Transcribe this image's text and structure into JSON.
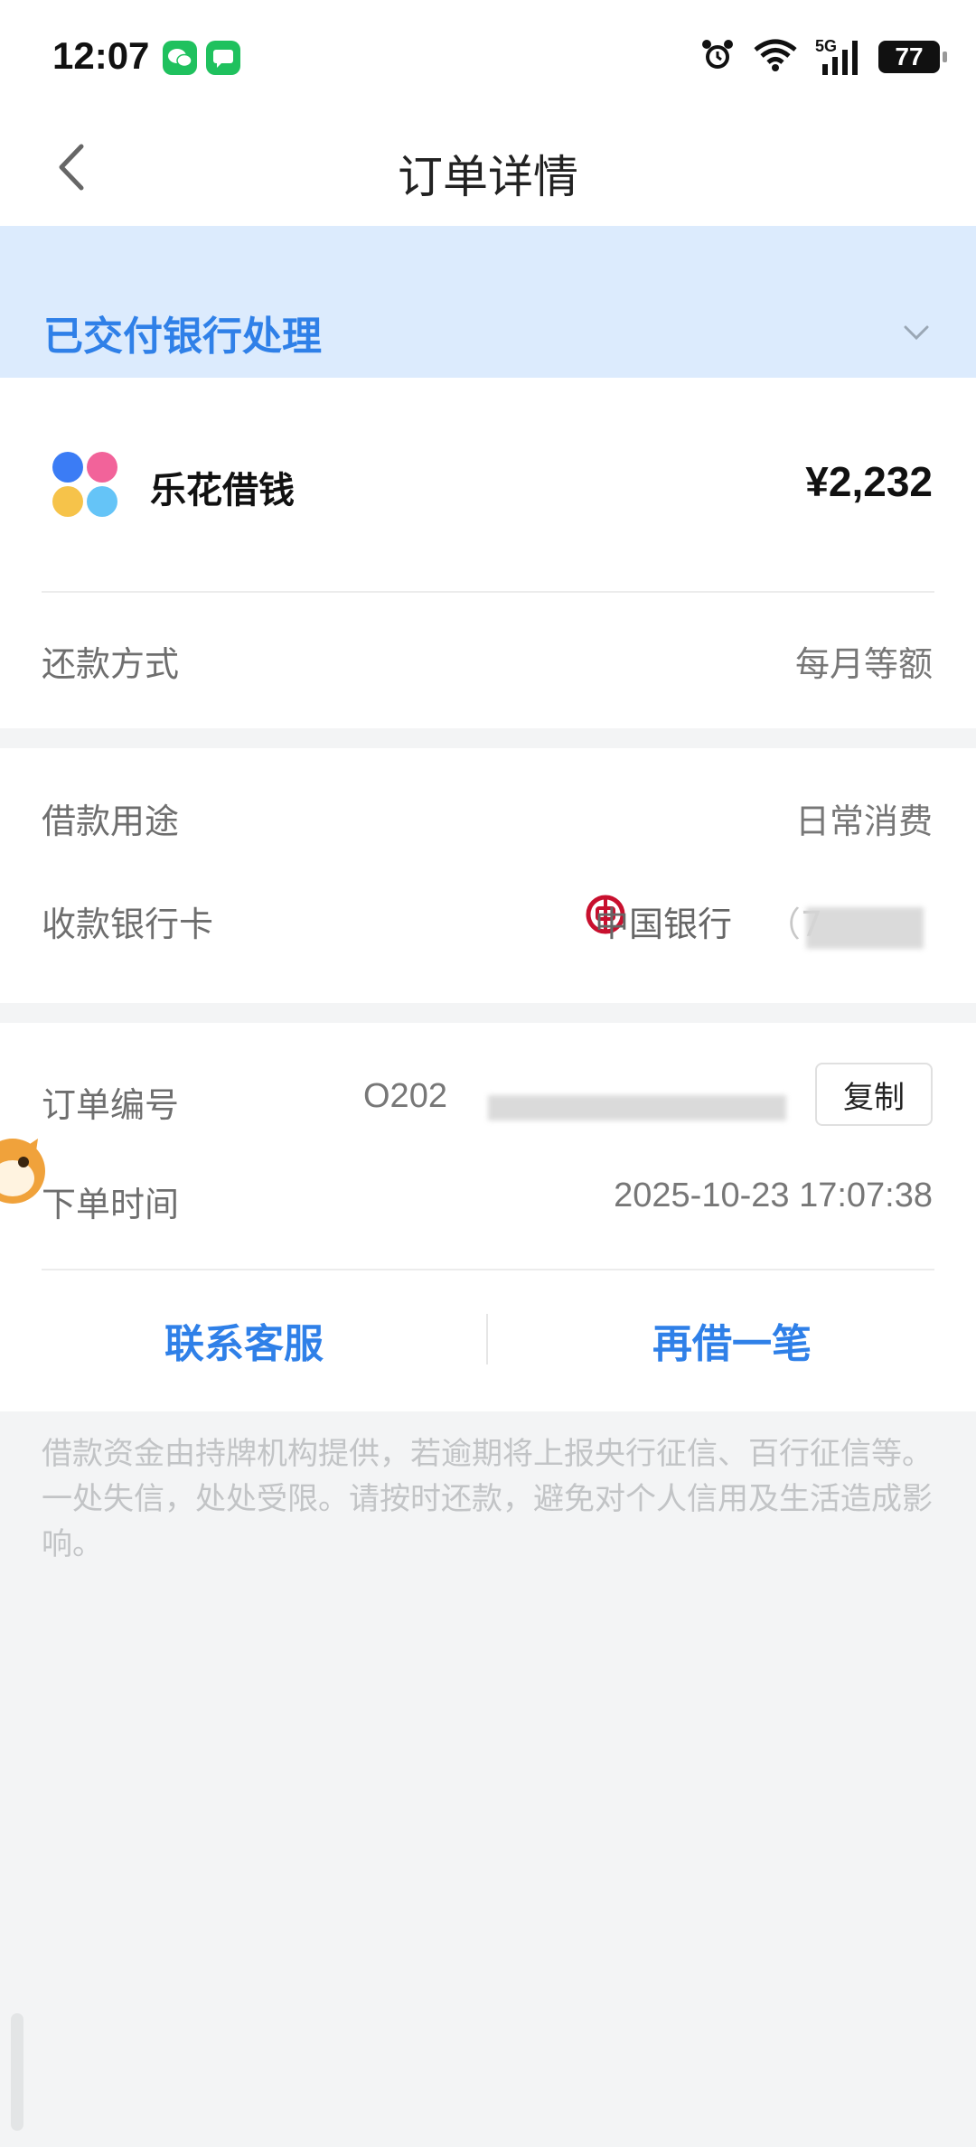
{
  "status_bar": {
    "time": "12:07",
    "signal_label": "5G",
    "battery_level": "77"
  },
  "nav": {
    "title": "订单详情"
  },
  "banner": {
    "status_text": "已交付银行处理"
  },
  "product": {
    "name": "乐花借钱",
    "amount": "¥2,232"
  },
  "repayment": {
    "label": "还款方式",
    "value": "每月等额"
  },
  "loan_purpose": {
    "label": "借款用途",
    "value": "日常消费"
  },
  "bank_card": {
    "label": "收款银行卡",
    "bank_name": "中国银行",
    "card_masked": "（7"
  },
  "order": {
    "number_label": "订单编号",
    "number_visible": "O202",
    "copy_label": "复制",
    "time_label": "下单时间",
    "time_value": "2025-10-23 17:07:38"
  },
  "actions": {
    "contact_label": "联系客服",
    "borrow_again_label": "再借一笔"
  },
  "disclaimer": "借款资金由持牌机构提供，若逾期将上报央行征信、百行征信等。一处失信，处处受限。请按时还款，避免对个人信用及生活造成影响。",
  "colors": {
    "accent": "#2f80e8",
    "banner_bg": "#dcebfd",
    "bank_red": "#c8102e"
  }
}
